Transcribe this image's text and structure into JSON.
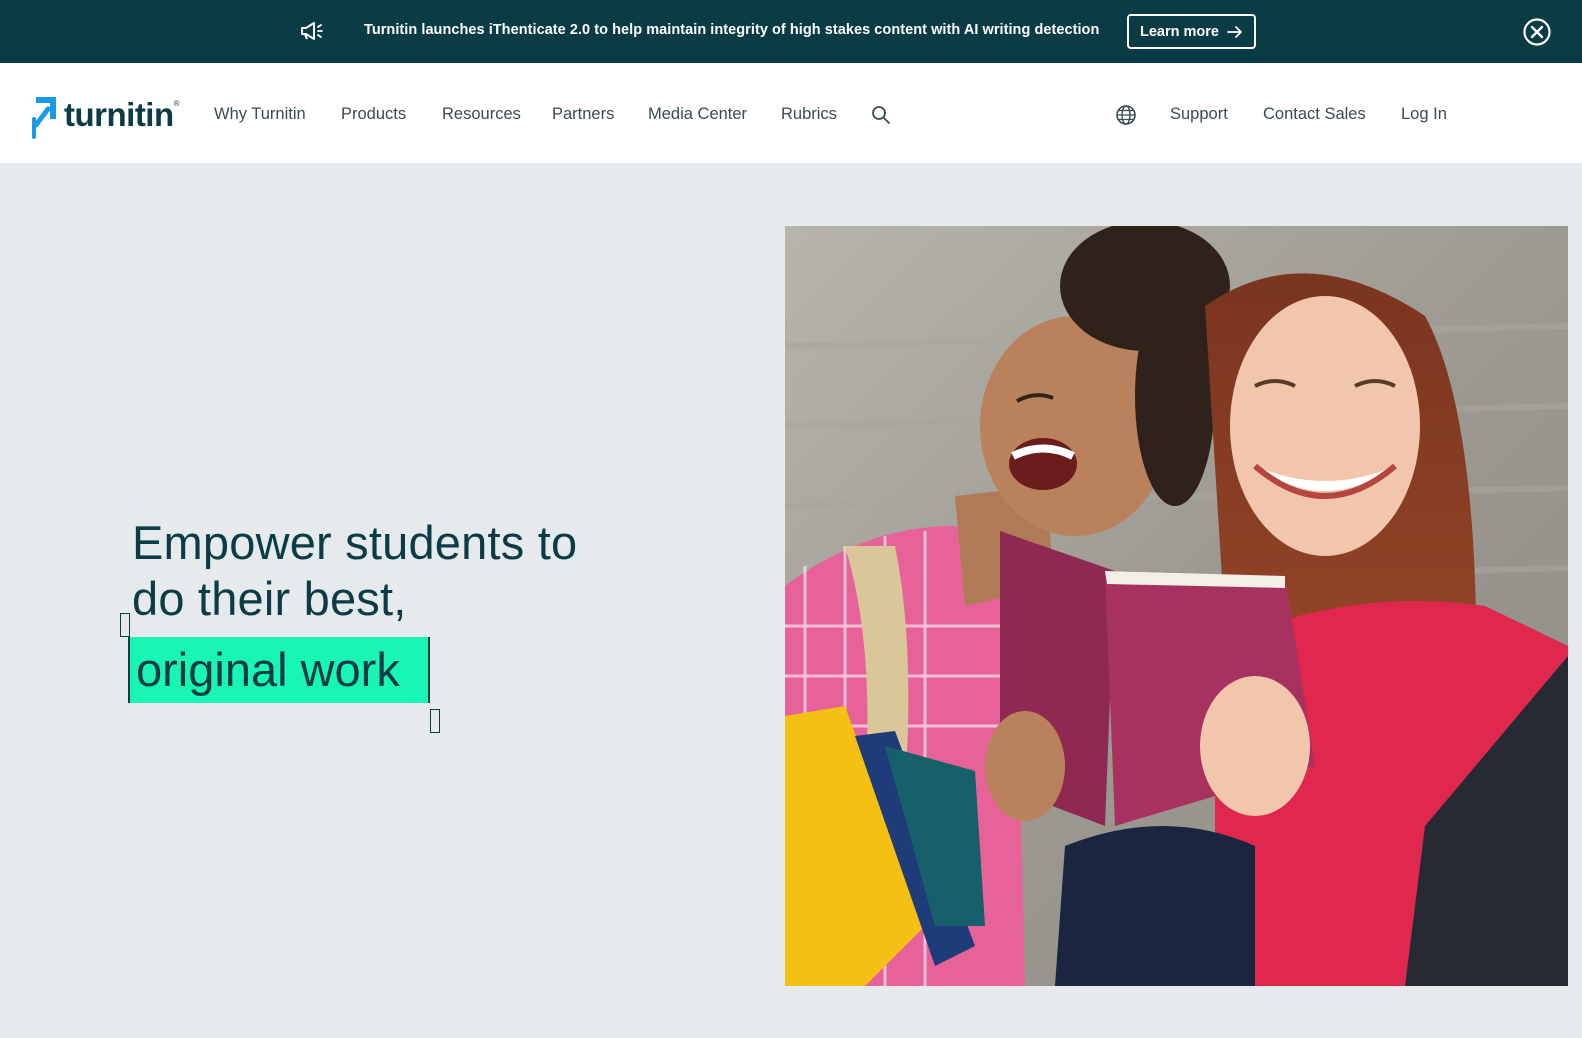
{
  "banner": {
    "message": "Turnitin launches iThenticate 2.0 to help maintain integrity of high stakes content with AI writing detection",
    "learn_more": "Learn more"
  },
  "logo": {
    "text": "turnitin",
    "tm": "®"
  },
  "nav": {
    "left": [
      "Why Turnitin",
      "Products",
      "Resources",
      "Partners",
      "Media Center",
      "Rubrics"
    ],
    "right": [
      "Support",
      "Contact Sales",
      "Log In"
    ]
  },
  "hero": {
    "line1": "Empower students to",
    "line2": "do their best,",
    "highlight": "original work"
  },
  "colors": {
    "banner_bg": "#0b3c46",
    "accent_green": "#19f5b2",
    "brand_blue": "#1a9be6",
    "hero_bg": "#e6eaed"
  },
  "icons": [
    "megaphone-icon",
    "arrow-right-icon",
    "close-circle-icon",
    "search-icon",
    "globe-icon"
  ]
}
